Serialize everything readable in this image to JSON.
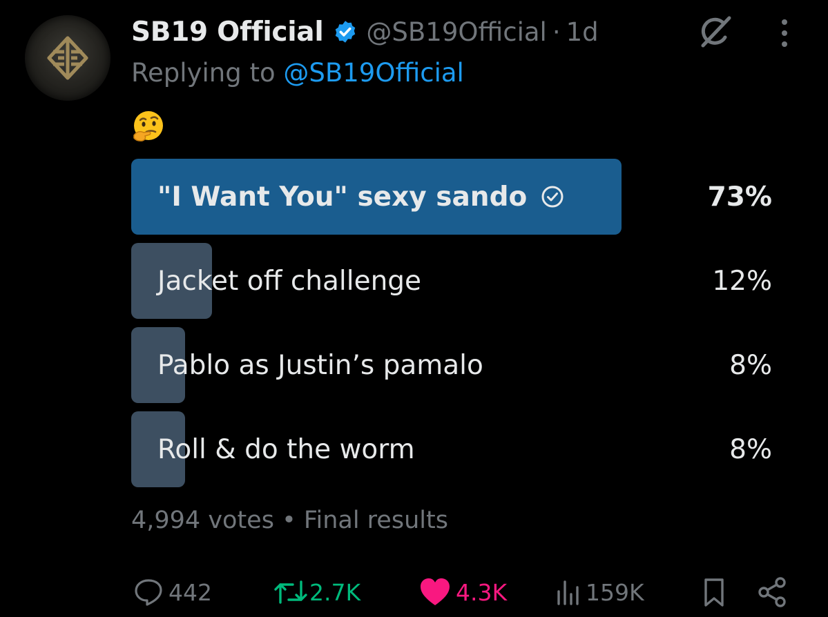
{
  "tweet": {
    "display_name": "SB19 Official",
    "handle": "@SB19Official",
    "separator": "·",
    "time": "1d",
    "replying_prefix": "Replying to",
    "replying_handle": "@SB19Official",
    "emoji": "thinking-face"
  },
  "poll": {
    "options": [
      {
        "label": "\"I Want You\" sexy sando",
        "percent_text": "73%",
        "fraction": 0.73,
        "winner": true
      },
      {
        "label": "Jacket off challenge",
        "percent_text": "12%",
        "fraction": 0.12,
        "winner": false
      },
      {
        "label": "Pablo as Justin’s pamalo",
        "percent_text": "8%",
        "fraction": 0.08,
        "winner": false
      },
      {
        "label": "Roll & do the worm",
        "percent_text": "8%",
        "fraction": 0.08,
        "winner": false
      }
    ],
    "votes": "4,994 votes",
    "meta_separator": "•",
    "status": "Final results"
  },
  "actions": {
    "replies": "442",
    "reposts": "2.7K",
    "likes": "4.3K",
    "views": "159K"
  },
  "icons": {
    "verified": "verified-badge-icon",
    "grok": "grok-icon",
    "more": "more-icon",
    "winner_check": "check-circle-icon",
    "reply": "reply-icon",
    "repost": "repost-icon",
    "like": "heart-icon",
    "views": "views-icon",
    "bookmark": "bookmark-icon",
    "share": "share-icon"
  },
  "colors": {
    "background": "#000000",
    "text": "#e7e9ea",
    "muted": "#71767b",
    "link": "#1d9bf0",
    "winner_bar": "#1a5d8f",
    "bar": "#3d4f61",
    "repost_active": "#00ba7c",
    "like_active": "#f91880"
  }
}
